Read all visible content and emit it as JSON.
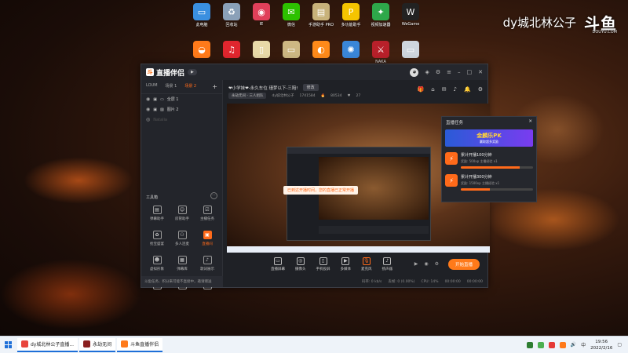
{
  "desktop_icons": [
    {
      "label": "此电脑",
      "icon": "computer-icon",
      "color": "#3a8fe0",
      "glyph": "▭"
    },
    {
      "label": "回收站",
      "icon": "recycle-bin-icon",
      "color": "#8aa0b8",
      "glyph": "♻"
    },
    {
      "label": "IE",
      "icon": "browser-icon",
      "color": "#e0405a",
      "glyph": "◉"
    },
    {
      "label": "微信",
      "icon": "wechat-icon",
      "color": "#2dc100",
      "glyph": "✉"
    },
    {
      "label": "手游助手 PRO",
      "icon": "folder-icon",
      "color": "#c8b27a",
      "glyph": "▤"
    },
    {
      "label": "多功能助手",
      "icon": "app-icon",
      "color": "#f5c400",
      "glyph": "P"
    },
    {
      "label": "视频加速器 ",
      "icon": "game-icon",
      "color": "#2ea84a",
      "glyph": "✦"
    },
    {
      "label": "WeGame",
      "icon": "wegame-icon",
      "color": "#222222",
      "glyph": "W"
    }
  ],
  "desktop_icons_row2": [
    {
      "label": "",
      "icon": "duck-app-icon",
      "color": "#ff7a1a",
      "glyph": "◒"
    },
    {
      "label": "",
      "icon": "netease-music-icon",
      "color": "#e0262e",
      "glyph": "♫"
    },
    {
      "label": "",
      "icon": "document-icon",
      "color": "#e8d9a8",
      "glyph": "▯"
    },
    {
      "label": "",
      "icon": "folder-icon",
      "color": "#cdb783",
      "glyph": "▭"
    },
    {
      "label": "",
      "icon": "douyu-icon",
      "color": "#ff8a1a",
      "glyph": "◐"
    },
    {
      "label": "",
      "icon": "blue-app-icon",
      "color": "#3a86d8",
      "glyph": "✺"
    },
    {
      "label": "NAKA",
      "icon": "game-icon",
      "color": "#b8202a",
      "glyph": "⚔"
    },
    {
      "label": "",
      "icon": "card-icon",
      "color": "#cfd6de",
      "glyph": "▭"
    }
  ],
  "watermark": {
    "text": "dy城北林公子",
    "brand": "斗鱼",
    "sub": "DOUYU.COM"
  },
  "app": {
    "title": "直播伴侣",
    "title_mark": "斗",
    "version": "▶",
    "left_tabs": [
      "LOUM",
      "场景 1",
      "场景 2"
    ],
    "scenes": [
      "全屏 1",
      "图片 2",
      "Natalia"
    ],
    "tools_title": "工具箱",
    "tools": [
      {
        "label": "弹幕助手",
        "icon": "danmaku-icon",
        "glyph": "▤"
      },
      {
        "label": "房管助手",
        "icon": "user-icon",
        "glyph": "☺"
      },
      {
        "label": "主播任务",
        "icon": "task-icon",
        "glyph": "☑"
      },
      {
        "label": "抢宝盛宴",
        "icon": "gift-icon",
        "glyph": "✿"
      },
      {
        "label": "多人连麦",
        "icon": "link-icon",
        "glyph": "⚇"
      },
      {
        "label": "直播间",
        "icon": "live-room-icon",
        "glyph": "▣"
      },
      {
        "label": "虚拟形象",
        "icon": "avatar-icon",
        "glyph": "☻"
      },
      {
        "label": "弹幕库",
        "icon": "library-icon",
        "glyph": "▦"
      },
      {
        "label": "歌词展示",
        "icon": "lyrics-icon",
        "glyph": "♪"
      },
      {
        "label": "",
        "icon": "more-tool-icon",
        "glyph": "⚠"
      },
      {
        "label": "",
        "icon": "more-tool-icon",
        "glyph": "♜"
      },
      {
        "label": "",
        "icon": "more-tool-icon",
        "glyph": "▤"
      }
    ],
    "tip": "斗鱼任务、积分来可能不直接中，邀请赠送",
    "stream_title": "❤小学妹❤-永久车位 瑾梦以下-三陪!",
    "edit_btn": "修改",
    "info": {
      "category": "永劫无间 - 三人组队",
      "user": "dy城北林公子",
      "room_id": "1741584",
      "hot": "80534",
      "fans": "27"
    },
    "tasks_panel": {
      "title": "直播任务",
      "banner_title": "金麟乐PK",
      "banner_sub": "赢取超多奖励",
      "items": [
        {
          "title": "累计开播100分钟",
          "reward": "奖励: 500xp 主播经验 x1",
          "progress": 0.82
        },
        {
          "title": "累计开播300分钟",
          "reward": "奖励: 1500xp 主播经验 x1",
          "progress": 0.4
        }
      ]
    },
    "toast": "已到达开播时间，您的直播已正常开播",
    "controls": [
      "直播屏幕",
      "摄像头",
      "手机投屏",
      "多媒体",
      "麦克风",
      "扬声器"
    ],
    "go_live": "开始直播",
    "status": [
      "码率: 0 kb/s",
      "丢帧: 0 (0.00%)",
      "CPU: 14%",
      "00:00:00",
      "00:00:00"
    ]
  },
  "taskbar": {
    "items": [
      {
        "label": "dy城北林公子直播...",
        "color": "#e8453c"
      },
      {
        "label": "永劫无间",
        "color": "#8a1f1f"
      },
      {
        "label": "斗鱼直播伴侣",
        "color": "#ff7a1a"
      }
    ],
    "time": "19:56",
    "date": "2022/2/16",
    "lang": "中"
  }
}
